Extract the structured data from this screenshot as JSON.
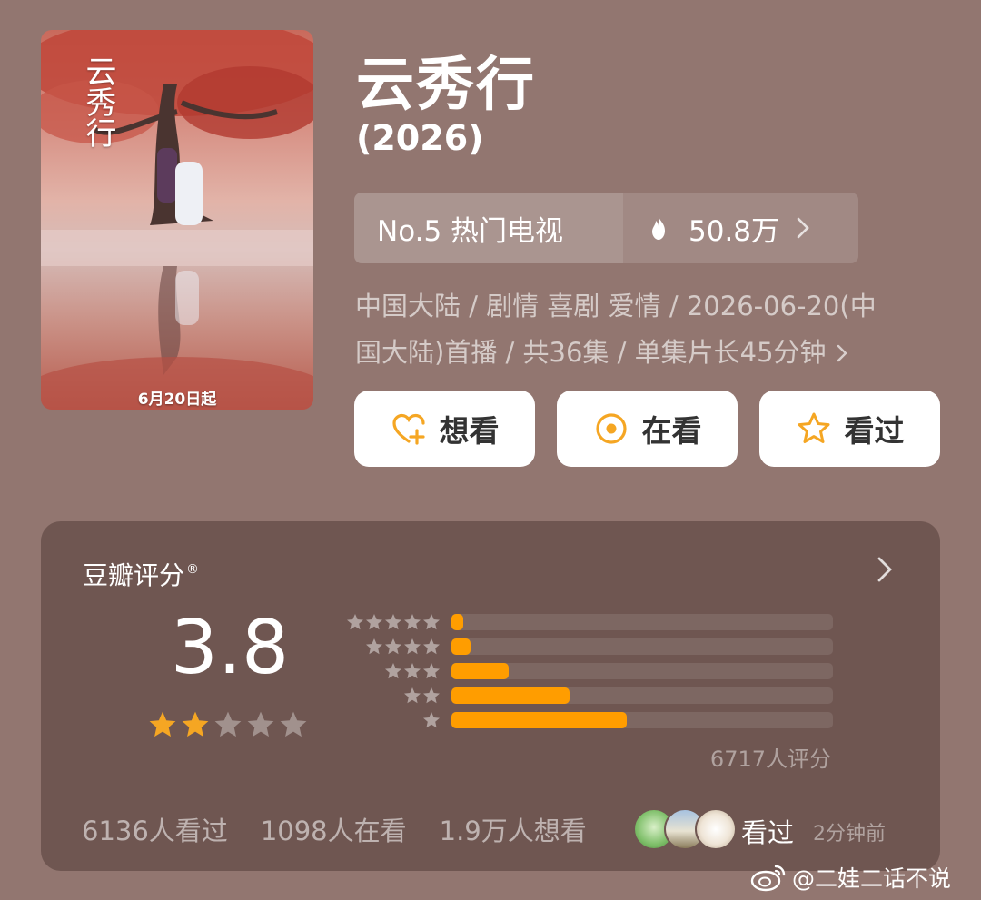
{
  "poster": {
    "title_art": "云秀行",
    "date_text": "6月20日起"
  },
  "title": "云秀行",
  "year": "(2026)",
  "rank": {
    "label": "No.5 热门电视",
    "heat": "50.8万",
    "icon": "fire-icon"
  },
  "meta": {
    "line1": "中国大陆 / 剧情 喜剧 爱情 / 2026-06-20(中",
    "line2": "国大陆)首播 / 共36集 / 单集片长45分钟"
  },
  "buttons": {
    "want": "想看",
    "watching": "在看",
    "watched": "看过"
  },
  "rating": {
    "title": "豆瓣评分",
    "registered": "®",
    "score": "3.8",
    "stars_filled": 2,
    "stars_total": 5,
    "distribution": [
      {
        "stars": 5,
        "fraction": 0.03
      },
      {
        "stars": 4,
        "fraction": 0.05
      },
      {
        "stars": 3,
        "fraction": 0.15
      },
      {
        "stars": 2,
        "fraction": 0.31
      },
      {
        "stars": 1,
        "fraction": 0.46
      }
    ],
    "count_text": "6717人评分"
  },
  "stats": {
    "watched": "6136人看过",
    "watching": "1098人在看",
    "want": "1.9万人想看",
    "friend_action": "看过",
    "friend_time": "2分钟前"
  },
  "watermark": "@二娃二话不说",
  "colors": {
    "background": "#927670",
    "card": "#6f5651",
    "accent": "#ff9d00",
    "star": "#f5a623"
  }
}
